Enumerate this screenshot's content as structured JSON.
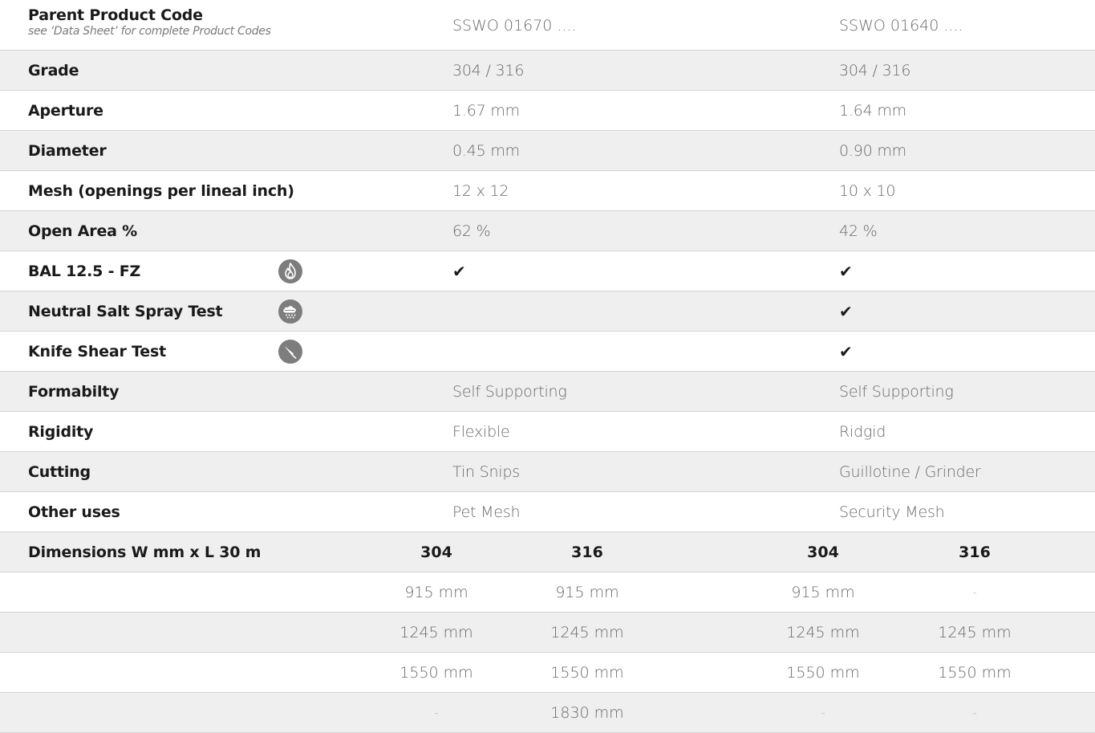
{
  "header": {
    "title": "Parent Product Code",
    "subtitle": "see ‘Data Sheet’ for complete Product Codes",
    "product_1": "SSWO 01670 ....",
    "product_2": "SSWO 01640 ...."
  },
  "specs": [
    {
      "label": "Grade",
      "v1": "304 / 316",
      "v2": "304 / 316"
    },
    {
      "label": "Aperture",
      "v1": "1.67 mm",
      "v2": "1.64 mm"
    },
    {
      "label": "Diameter",
      "v1": "0.45 mm",
      "v2": "0.90 mm"
    },
    {
      "label": "Mesh (openings per lineal inch)",
      "v1": "12 x 12",
      "v2": "10 x 10"
    },
    {
      "label": "Open Area %",
      "v1": "62 %",
      "v2": "42 %"
    }
  ],
  "tests": [
    {
      "label": "BAL 12.5 - FZ",
      "icon": "fire-icon",
      "v1": "✔",
      "v2": "✔"
    },
    {
      "label": "Neutral Salt Spray Test",
      "icon": "salt-spray-cloud-icon",
      "v1": "",
      "v2": "✔"
    },
    {
      "label": "Knife Shear Test",
      "icon": "knife-icon",
      "v1": "",
      "v2": "✔"
    }
  ],
  "properties": [
    {
      "label": "Formabilty",
      "v1": "Self Supporting",
      "v2": "Self Supporting"
    },
    {
      "label": "Rigidity",
      "v1": "Flexible",
      "v2": "Ridgid"
    },
    {
      "label": "Cutting",
      "v1": "Tin Snips",
      "v2": "Guillotine / Grinder"
    },
    {
      "label": "Other uses",
      "v1": "Pet Mesh",
      "v2": "Security Mesh"
    }
  ],
  "dimensions": {
    "label": "Dimensions W mm x L 30 m",
    "headers": [
      "304",
      "316",
      "304",
      "316"
    ],
    "rows": [
      [
        "915 mm",
        "915 mm",
        "915 mm",
        "-"
      ],
      [
        "1245 mm",
        "1245 mm",
        "1245 mm",
        "1245 mm"
      ],
      [
        "1550 mm",
        "1550 mm",
        "1550 mm",
        "1550 mm"
      ],
      [
        "-",
        "1830 mm",
        "-",
        "-"
      ]
    ]
  },
  "colors": {
    "stripe": "#efefef",
    "border": "#d4d4d4",
    "icon_bg": "#7d7d7d",
    "label_text": "#1a1a1a",
    "value_text": "#6a6a6a"
  }
}
